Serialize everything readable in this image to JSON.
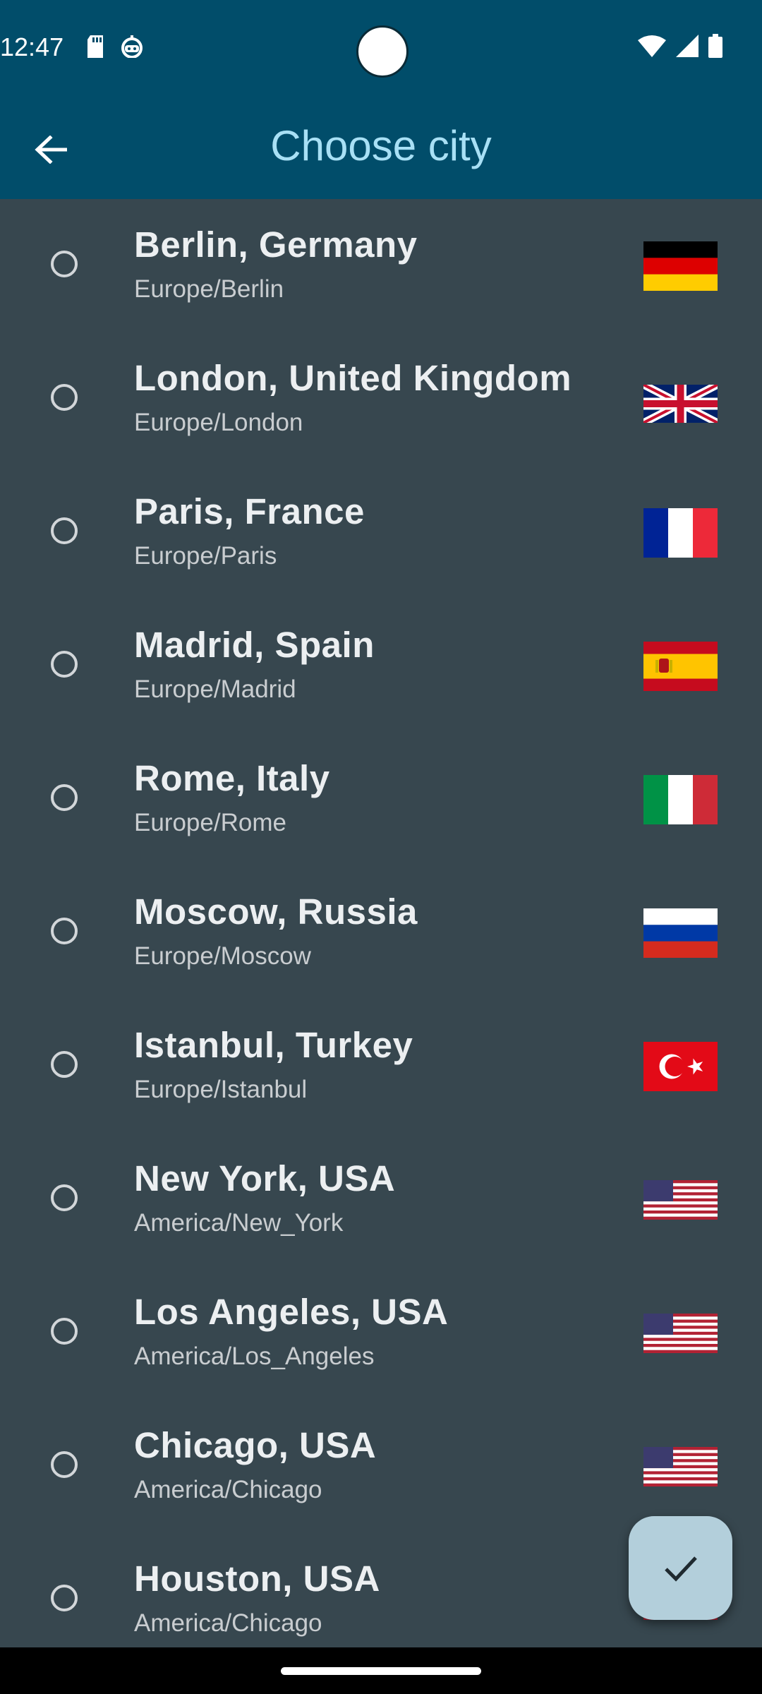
{
  "status_bar": {
    "time": "12:47",
    "left_icons": [
      "sd-card-icon",
      "robot-icon"
    ],
    "right_icons": [
      "wifi-icon",
      "signal-icon",
      "battery-icon"
    ]
  },
  "app_bar": {
    "title": "Choose city",
    "back_icon": "arrow-left-icon"
  },
  "cities": [
    {
      "name": "Berlin, Germany",
      "zone": "Europe/Berlin",
      "flag": "germany-flag-icon",
      "selected": false
    },
    {
      "name": "London, United Kingdom",
      "zone": "Europe/London",
      "flag": "uk-flag-icon",
      "selected": false
    },
    {
      "name": "Paris, France",
      "zone": "Europe/Paris",
      "flag": "france-flag-icon",
      "selected": false
    },
    {
      "name": "Madrid, Spain",
      "zone": "Europe/Madrid",
      "flag": "spain-flag-icon",
      "selected": false
    },
    {
      "name": "Rome, Italy",
      "zone": "Europe/Rome",
      "flag": "italy-flag-icon",
      "selected": false
    },
    {
      "name": "Moscow, Russia",
      "zone": "Europe/Moscow",
      "flag": "russia-flag-icon",
      "selected": false
    },
    {
      "name": "Istanbul, Turkey",
      "zone": "Europe/Istanbul",
      "flag": "turkey-flag-icon",
      "selected": false
    },
    {
      "name": "New York, USA",
      "zone": "America/New_York",
      "flag": "usa-flag-icon",
      "selected": false
    },
    {
      "name": "Los Angeles, USA",
      "zone": "America/Los_Angeles",
      "flag": "usa-flag-icon",
      "selected": false
    },
    {
      "name": "Chicago, USA",
      "zone": "America/Chicago",
      "flag": "usa-flag-icon",
      "selected": false
    },
    {
      "name": "Houston, USA",
      "zone": "America/Chicago",
      "flag": "usa-flag-icon",
      "selected": false
    }
  ],
  "fab": {
    "icon": "check-icon"
  },
  "colors": {
    "app_bar": "#014d6a",
    "title": "#a8e0f5",
    "background": "#37474f",
    "fab": "#b3cfdb"
  }
}
